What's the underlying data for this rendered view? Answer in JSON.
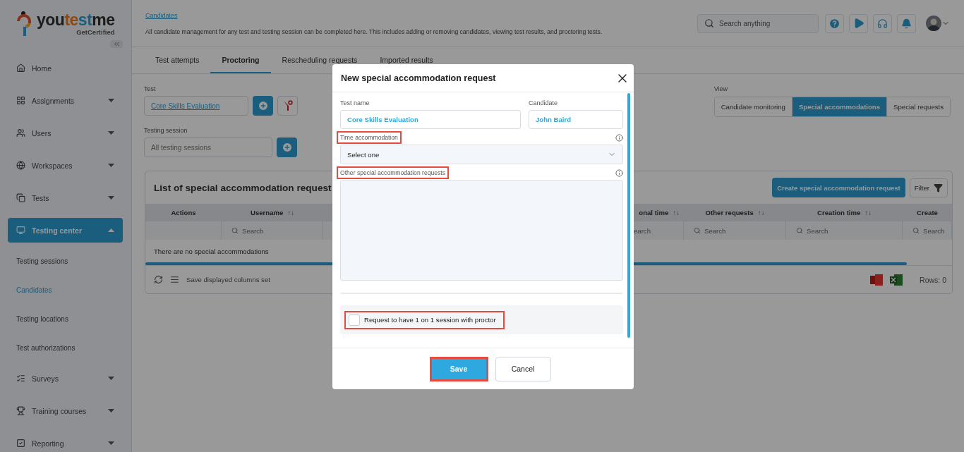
{
  "logo": {
    "parts": [
      "you",
      "te",
      "st",
      "me"
    ],
    "tagline": "GetCertified"
  },
  "sidebar": {
    "items": [
      {
        "label": "Home",
        "selected": false
      },
      {
        "label": "Assignments",
        "selected": false,
        "expanded": false
      },
      {
        "label": "Users",
        "selected": false,
        "expanded": false
      },
      {
        "label": "Workspaces",
        "selected": false,
        "expanded": false
      },
      {
        "label": "Tests",
        "selected": false,
        "expanded": false
      },
      {
        "label": "Testing center",
        "selected": true,
        "expanded": true,
        "children": [
          {
            "label": "Testing sessions",
            "selected": false
          },
          {
            "label": "Candidates",
            "selected": true
          },
          {
            "label": "Testing locations",
            "selected": false
          },
          {
            "label": "Test authorizations",
            "selected": false
          }
        ]
      },
      {
        "label": "Surveys",
        "selected": false,
        "expanded": false
      },
      {
        "label": "Training courses",
        "selected": false,
        "expanded": false
      },
      {
        "label": "Reporting",
        "selected": false,
        "expanded": false
      }
    ]
  },
  "header": {
    "breadcrumb": "Candidates",
    "description": "All candidate management for any test and testing session can be completed here. This includes adding or removing candidates, viewing test results, and proctoring tests.",
    "search": {
      "placeholder": "Search anything"
    }
  },
  "tabs": [
    {
      "label": "Test attempts",
      "selected": false
    },
    {
      "label": "Proctoring",
      "selected": true
    },
    {
      "label": "Rescheduling requests",
      "selected": false
    },
    {
      "label": "Imported results",
      "selected": false
    }
  ],
  "filters": {
    "test": {
      "label": "Test",
      "value": "Core Skills Evaluation"
    },
    "session": {
      "label": "Testing session",
      "placeholder": "All testing sessions"
    },
    "view": {
      "label": "View",
      "options": [
        {
          "label": "Candidate monitoring",
          "selected": false
        },
        {
          "label": "Special accommodations",
          "selected": true
        },
        {
          "label": "Special requests",
          "selected": false
        }
      ]
    }
  },
  "card": {
    "title": "List of special accommodation request",
    "create_button": "Create special accommodation request",
    "filter_button": "Filter",
    "columns": [
      {
        "label": "Actions"
      },
      {
        "label": "Username",
        "sort": "↑↓",
        "search": "Search"
      },
      {
        "label": "onal time",
        "sort": "↑↓",
        "search": "earch"
      },
      {
        "label": "Other requests",
        "sort": "↑↓",
        "search": "Search"
      },
      {
        "label": "Creation time",
        "sort": "↑↓",
        "search": "Search"
      },
      {
        "label": "Create",
        "search": "Search"
      }
    ],
    "empty_message": "There are no special accommodations",
    "save_columns": "Save displayed columns set",
    "rows": "Rows: 0"
  },
  "modal": {
    "title": "New special accommodation request",
    "test_name": {
      "label": "Test name",
      "value": "Core Skills Evaluation"
    },
    "candidate": {
      "label": "Candidate",
      "value": "John Baird"
    },
    "time": {
      "label": "Time accommodation",
      "highlighted": true,
      "placeholder": "Select one"
    },
    "other": {
      "label": "Other special accommodation requests",
      "highlighted": true
    },
    "one_on_one": {
      "label": "Request to have 1 on 1 session with proctor",
      "checked": false,
      "highlighted": true
    },
    "save": {
      "label": "Save",
      "highlighted": true
    },
    "cancel": {
      "label": "Cancel"
    }
  }
}
